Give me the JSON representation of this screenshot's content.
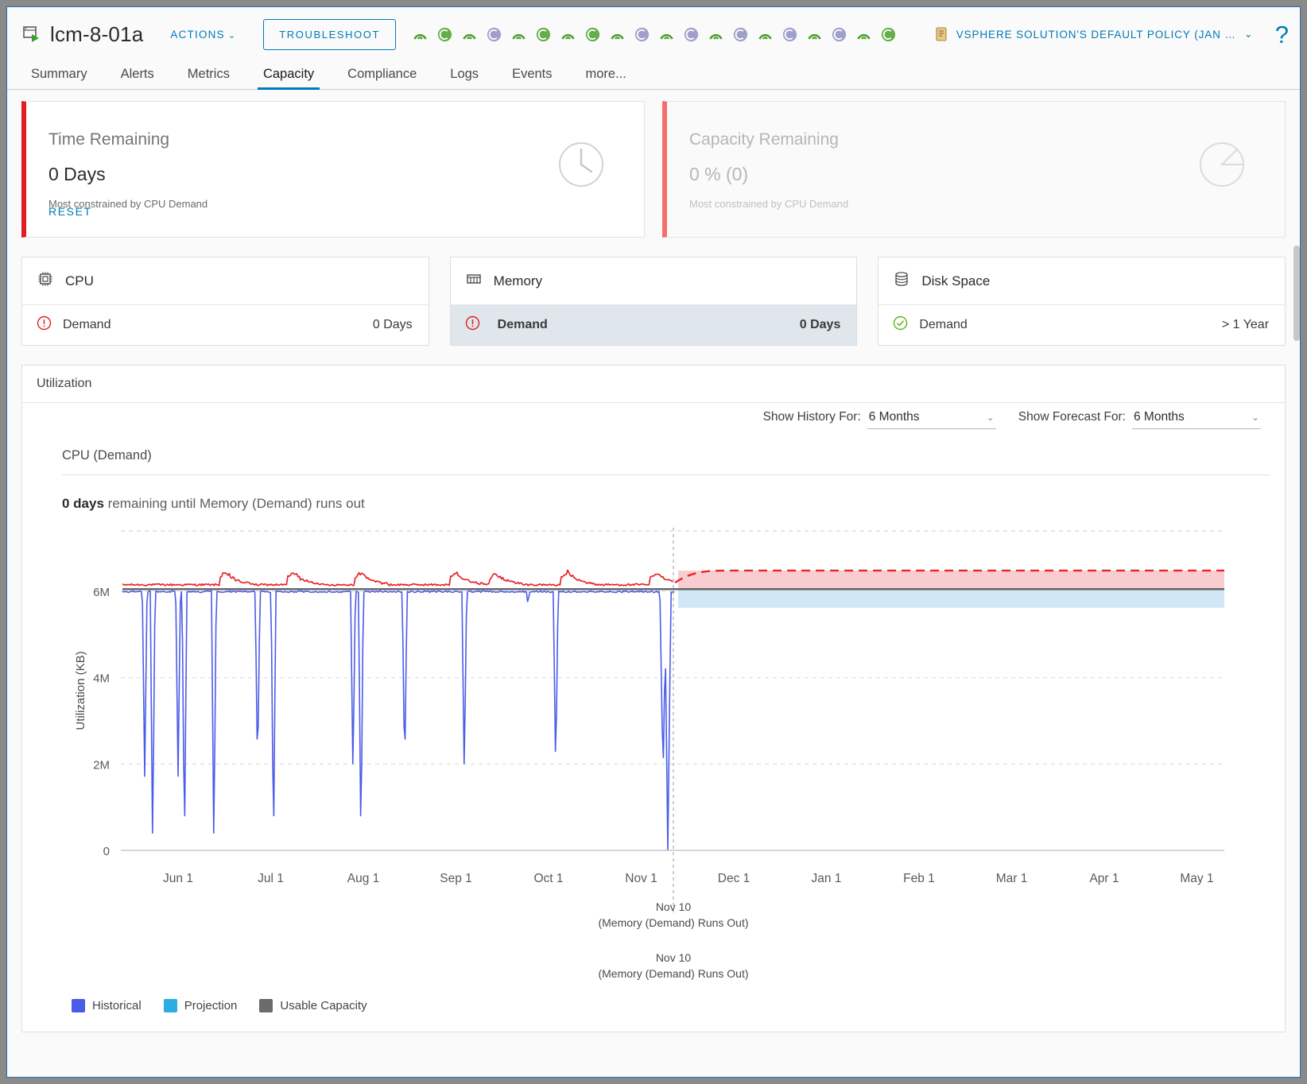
{
  "header": {
    "object_icon": "vm-object-icon",
    "title": "lcm-8-01a",
    "actions_label": "ACTIONS",
    "actions_caret": "chevron-down-icon",
    "troubleshoot_label": "TROUBLESHOOT",
    "policy_icon": "policy-scroll-icon",
    "policy_label": "VSPHERE SOLUTION'S DEFAULT POLICY (JAN …",
    "policy_caret": "chevron-down-icon",
    "help_label": "?",
    "badges": [
      {
        "type": "arc",
        "color": "#4aa02c"
      },
      {
        "type": "circle",
        "color": "#4aa02c"
      },
      {
        "type": "arc",
        "color": "#4aa02c"
      },
      {
        "type": "circle",
        "color": "#8e8ec0"
      },
      {
        "type": "arc",
        "color": "#4aa02c"
      },
      {
        "type": "circle",
        "color": "#4aa02c"
      },
      {
        "type": "arc",
        "color": "#4aa02c"
      },
      {
        "type": "circle",
        "color": "#4aa02c"
      },
      {
        "type": "arc",
        "color": "#4aa02c"
      },
      {
        "type": "circle",
        "color": "#8e8ec0"
      },
      {
        "type": "arc",
        "color": "#4aa02c"
      },
      {
        "type": "circle",
        "color": "#8e8ec0"
      },
      {
        "type": "arc",
        "color": "#4aa02c"
      },
      {
        "type": "circle",
        "color": "#8e8ec0"
      },
      {
        "type": "arc",
        "color": "#4aa02c"
      },
      {
        "type": "circle",
        "color": "#8e8ec0"
      },
      {
        "type": "arc",
        "color": "#4aa02c"
      },
      {
        "type": "circle",
        "color": "#8e8ec0"
      },
      {
        "type": "arc",
        "color": "#4aa02c"
      },
      {
        "type": "circle",
        "color": "#4aa02c"
      }
    ]
  },
  "tabs": [
    {
      "label": "Summary",
      "active": false
    },
    {
      "label": "Alerts",
      "active": false
    },
    {
      "label": "Metrics",
      "active": false
    },
    {
      "label": "Capacity",
      "active": true
    },
    {
      "label": "Compliance",
      "active": false
    },
    {
      "label": "Logs",
      "active": false
    },
    {
      "label": "Events",
      "active": false
    },
    {
      "label": "more...",
      "active": false
    }
  ],
  "summary_cards": [
    {
      "title": "Time Remaining",
      "value": "0 Days",
      "sub": "Most constrained by CPU Demand",
      "reset": "RESET",
      "icon": "clock-icon"
    },
    {
      "title": "Capacity Remaining",
      "value": "0 % (0)",
      "sub": "Most constrained by CPU Demand",
      "icon": "pie-chart-icon"
    }
  ],
  "resource_cards": [
    {
      "icon": "cpu-chip-icon",
      "name": "CPU",
      "status": "critical",
      "status_icon": "error-exclamation-icon",
      "metric": "Demand",
      "value": "0 Days",
      "selected": false
    },
    {
      "icon": "memory-module-icon",
      "name": "Memory",
      "status": "critical",
      "status_icon": "error-exclamation-icon",
      "metric": "Demand",
      "value": "0 Days",
      "selected": true
    },
    {
      "icon": "disk-stack-icon",
      "name": "Disk Space",
      "status": "ok",
      "status_icon": "check-circle-icon",
      "metric": "Demand",
      "value": "> 1 Year",
      "selected": false
    }
  ],
  "utilization": {
    "panel_title": "Utilization",
    "history_label": "Show History For:",
    "history_value": "6 Months",
    "forecast_label": "Show Forecast For:",
    "forecast_value": "6 Months",
    "sub_tab": "CPU (Demand)",
    "caption_strong": "0 days",
    "caption_rest": " remaining until Memory (Demand) runs out"
  },
  "chart_data": {
    "type": "line",
    "title": "",
    "xlabel": "",
    "ylabel": "Utilization (KB)",
    "ylim": [
      0,
      7400000
    ],
    "yticks": [
      0,
      2000000,
      4000000,
      6000000
    ],
    "ytick_labels": [
      "0",
      "2M",
      "4M",
      "6M"
    ],
    "xtick_labels": [
      "Jun 1",
      "Jul 1",
      "Aug 1",
      "Sep 1",
      "Oct 1",
      "Nov 1",
      "Dec 1",
      "Jan 1",
      "Feb 1",
      "Mar 1",
      "Apr 1",
      "May 1"
    ],
    "grid": true,
    "legend_position": "bottom-left",
    "legend": [
      {
        "label": "Historical",
        "color": "#4b5ce8"
      },
      {
        "label": "Projection",
        "color": "#2aaee0"
      },
      {
        "label": "Usable Capacity",
        "color": "#6b6b6b"
      }
    ],
    "forecast_marker": {
      "date_label": "Nov 10",
      "note": "(Memory (Demand) Runs Out)",
      "repeat_date_label": "Nov 10",
      "repeat_note": "(Memory (Demand) Runs Out)"
    },
    "series": [
      {
        "name": "Historical",
        "color": "#4b5ce8",
        "description": "Dense band near 6.05M KB with periodic deep downward spikes to between 0 and 2M KB",
        "baseline": 6050000,
        "spikes_to_zero_days": [
          "Jun 2",
          "Jun 7",
          "Jun 12",
          "Jul 5",
          "Jul 22"
        ],
        "spikes_to_2m_days": [
          "May 26",
          "Jun 20",
          "Jul 28",
          "Aug 10",
          "Sep 3",
          "Oct 5",
          "Nov 8"
        ]
      },
      {
        "name": "Upper band (red)",
        "color": "#e8242b",
        "description": "Noisy red trace slightly above the usable capacity line, ranging 6.1M to 6.45M KB",
        "min": 6100000,
        "max": 6450000
      },
      {
        "name": "Usable Capacity",
        "color": "#6b6b6b",
        "description": "Flat horizontal capacity line",
        "value": 6050000
      },
      {
        "name": "Projection upper bound",
        "color": "#e8242b",
        "style": "dashed",
        "description": "Dashed red forecast line at the top of the pink confidence band",
        "value": 6480000
      },
      {
        "name": "Projection band (pink)",
        "color": "#f7c4c6",
        "description": "Pink shaded forecast band above the usable capacity line",
        "low": 6060000,
        "high": 6480000
      },
      {
        "name": "Projection band (blue)",
        "color": "#cfe6f4",
        "description": "Light blue shaded forecast band below the usable capacity line",
        "low": 5620000,
        "high": 6040000
      }
    ]
  }
}
